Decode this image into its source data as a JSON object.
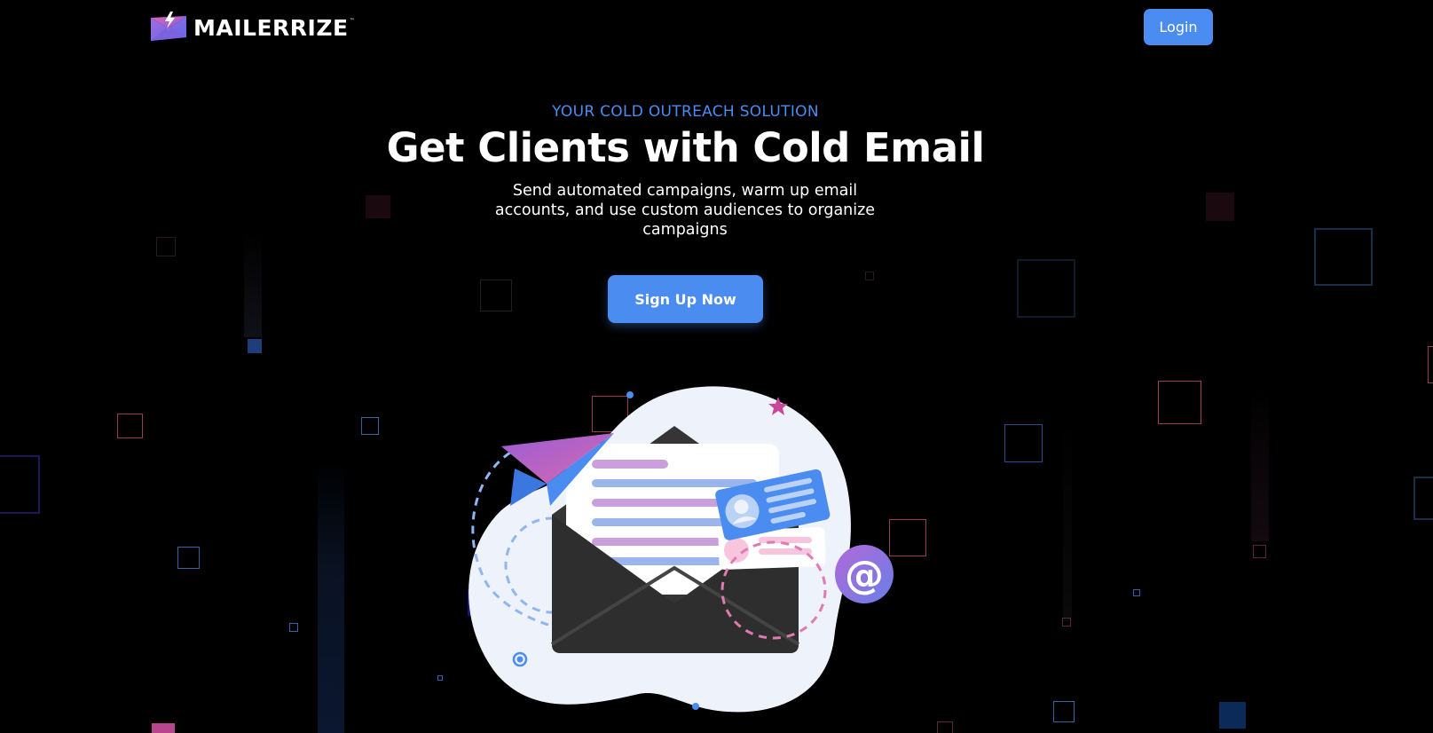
{
  "header": {
    "brand_name": "MAILERRIZE",
    "brand_tm": "™",
    "login_label": "Login"
  },
  "hero": {
    "eyebrow": "YOUR COLD OUTREACH SOLUTION",
    "headline": "Get Clients with Cold Email",
    "subtext": "Send automated campaigns, warm up email accounts, and use custom audiences to organize campaigns",
    "cta_label": "Sign Up Now"
  },
  "colors": {
    "background": "#000000",
    "accent_blue": "#4b8cf0",
    "accent_pink": "#e07ab0",
    "accent_purple": "#9b5cd6"
  },
  "icons": {
    "logo": "envelope-lightning-logo",
    "illustration": "open-envelope-paper-plane-illustration",
    "at_sign": "at-sign-icon"
  }
}
